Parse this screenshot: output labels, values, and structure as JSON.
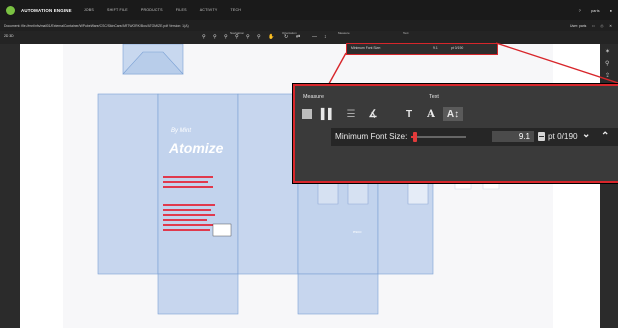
{
  "app": {
    "brand": "AUTOMATION ENGINE",
    "nav": [
      "JOBS",
      "SHIFT FILE",
      "PRODUCTS",
      "FILES",
      "ACTIVITY",
      "TECH"
    ],
    "user": "paris"
  },
  "document": {
    "path_prefix": "Document:",
    "path": "file://mnt/nfs/mail01/ExternalContainer/WPubeWare/CSC/SkinCare/ARTWORK/Box/ATOMIZE.pdf",
    "version_label": "Version: 1(A)",
    "user_label": "User: paris"
  },
  "toolbar": {
    "view_mode": "2D  3D",
    "groups": [
      "Navigation",
      "Orientation",
      "Measure",
      "Text"
    ]
  },
  "overlay_small": {
    "label": "Minimum Font Size:",
    "value": "9.1",
    "unit": "pt 0/190"
  },
  "zoom": {
    "measure_label": "Measure",
    "text_label": "Text",
    "min_font_label": "Minimum Font Size:",
    "min_font_value": "9.1",
    "unit_label": "pt 0/190",
    "slider_fraction": 0.07
  },
  "artwork": {
    "title_small": "By Mint",
    "title_large": "Atomize",
    "bottom_badge": "esco"
  }
}
